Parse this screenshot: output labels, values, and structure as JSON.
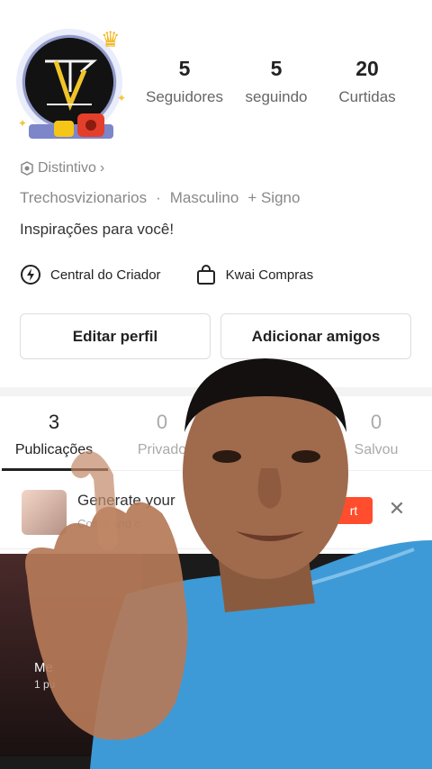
{
  "profile": {
    "stats": [
      {
        "value": "5",
        "label": "Seguidores"
      },
      {
        "value": "5",
        "label": "seguindo"
      },
      {
        "value": "20",
        "label": "Curtidas"
      }
    ],
    "badge_label": "Distintivo",
    "username": "Trechosvizionarios",
    "dot": "·",
    "gender": "Masculino",
    "sign": "+ Signo",
    "bio": "Inspirações para você!"
  },
  "links": {
    "creator_center": "Central do Criador",
    "kwai_shop": "Kwai Compras"
  },
  "buttons": {
    "edit_profile": "Editar perfil",
    "add_friends": "Adicionar amigos"
  },
  "tabs": [
    {
      "count": "3",
      "label": "Publicações"
    },
    {
      "count": "0",
      "label": "Privado"
    },
    {
      "count": "0",
      "label": "Salvou"
    }
  ],
  "banner": {
    "title": "Generate your",
    "subtitle": "Come and c",
    "action": "rt"
  },
  "grid": {
    "item_name": "Me",
    "item_count": "1 pu"
  },
  "colors": {
    "accent": "#ff4d2e",
    "text_primary": "#222222",
    "text_secondary": "#888888"
  }
}
